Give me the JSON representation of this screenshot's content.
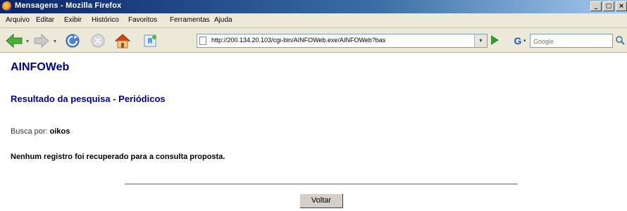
{
  "window": {
    "title": "Mensagens - Mozilla Firefox"
  },
  "menu": [
    "Arquivo",
    "Editar",
    "Exibir",
    "Histórico",
    "Favoritos",
    "Ferramentas",
    "Ajuda"
  ],
  "toolbar": {
    "url": "http://200.134.20.103/cgi-bin/AINFOWeb.exe/AINFOWeb?bas",
    "search_placeholder": "Google",
    "icons": [
      "back-arrow-icon",
      "forward-arrow-icon",
      "reload-icon",
      "stop-icon",
      "home-icon",
      "bookmark-icon",
      "go-icon",
      "google-search-icon",
      "search-magnifier-icon"
    ]
  },
  "page": {
    "site_title": "AINFOWeb",
    "heading": "Resultado da pesquisa - Periódicos",
    "search_label": "Busca por:",
    "search_term": "oikos",
    "no_results": "Nenhum registro foi recuperado para a consulta proposta.",
    "back_button": "Voltar"
  },
  "colors": {
    "heading": "#00008b",
    "titlebar": "#0a246a",
    "chrome": "#ece9d8",
    "go_green": "#2e9e2e"
  }
}
